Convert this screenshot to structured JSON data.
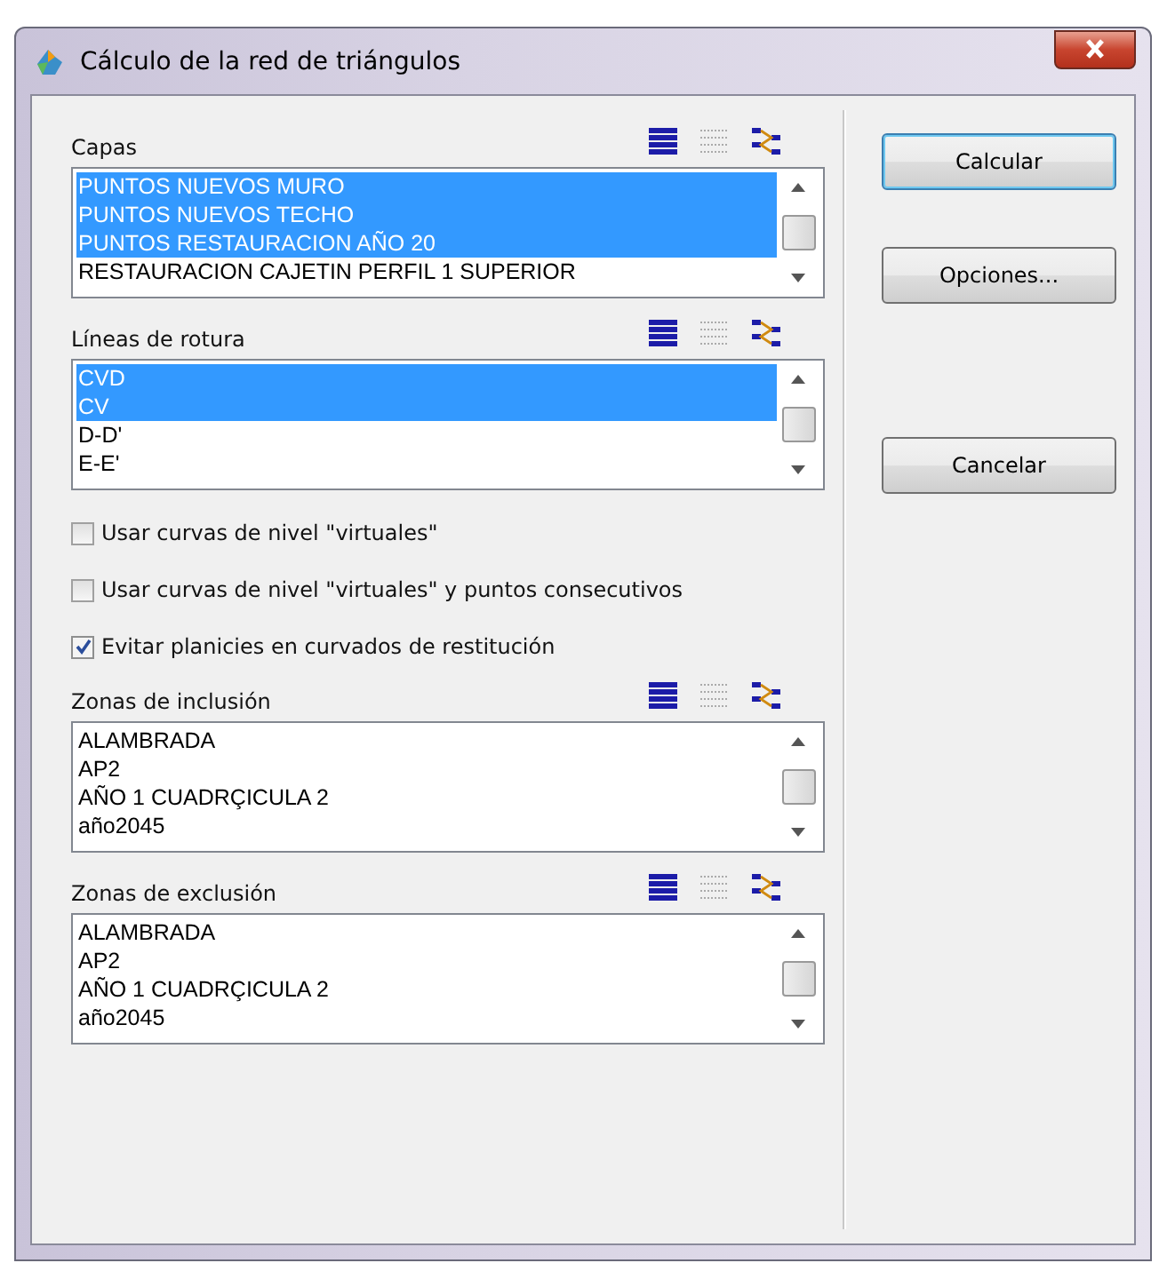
{
  "window": {
    "title": "Cálculo de la red de triángulos"
  },
  "left_panel": [
    {
      "kind": "list",
      "label": "Capas",
      "items": [
        {
          "text": "PUNTOS NUEVOS MURO",
          "selected": true
        },
        {
          "text": "PUNTOS NUEVOS TECHO",
          "selected": true
        },
        {
          "text": "PUNTOS RESTAURACION AÑO 20",
          "selected": true
        },
        {
          "text": "RESTAURACION CAJETIN PERFIL 1 SUPERIOR",
          "selected": false
        }
      ]
    },
    {
      "kind": "list",
      "label": "Líneas de rotura",
      "items": [
        {
          "text": "CVD",
          "selected": true
        },
        {
          "text": "CV",
          "selected": true
        },
        {
          "text": "D-D'",
          "selected": false
        },
        {
          "text": "E-E'",
          "selected": false
        }
      ]
    },
    {
      "kind": "checkbox",
      "label": "Usar curvas de nivel \"virtuales\"",
      "checked": false
    },
    {
      "kind": "checkbox",
      "label": "Usar curvas de nivel \"virtuales\" y puntos consecutivos",
      "checked": false
    },
    {
      "kind": "checkbox",
      "label": "Evitar planicies en curvados de restitución",
      "checked": true
    },
    {
      "kind": "list",
      "label": "Zonas de inclusión",
      "items": [
        {
          "text": "ALAMBRADA",
          "selected": false
        },
        {
          "text": "AP2",
          "selected": false
        },
        {
          "text": "AÑO 1 CUADRÇICULA 2",
          "selected": false
        },
        {
          "text": "año2045",
          "selected": false
        }
      ]
    },
    {
      "kind": "list",
      "label": "Zonas de exclusión",
      "items": [
        {
          "text": "ALAMBRADA",
          "selected": false
        },
        {
          "text": "AP2",
          "selected": false
        },
        {
          "text": "AÑO 1 CUADRÇICULA 2",
          "selected": false
        },
        {
          "text": "año2045",
          "selected": false
        }
      ]
    }
  ],
  "buttons": [
    {
      "label": "Calcular",
      "default": true
    },
    {
      "label": "Opciones...",
      "default": false
    },
    {
      "label": "Cancelar",
      "default": false
    }
  ]
}
